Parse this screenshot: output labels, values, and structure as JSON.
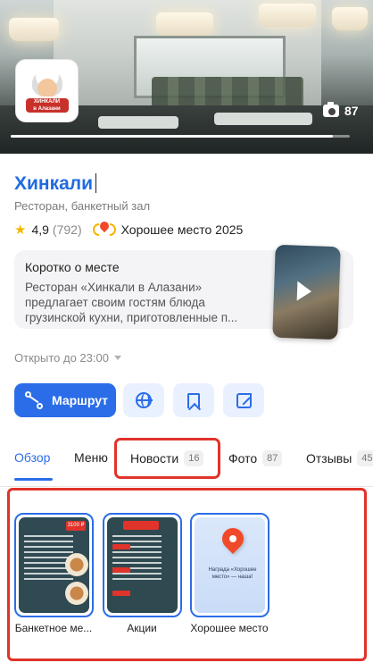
{
  "hero": {
    "photo_count": "87",
    "progress": 0.95
  },
  "logo": {
    "line1": "ХИНКАЛИ",
    "line2": "в Алазани"
  },
  "place": {
    "name": "Хинкали",
    "category": "Ресторан, банкетный зал",
    "rating": "4,9",
    "reviews_count": "(792)",
    "award": "Хорошее место 2025"
  },
  "about": {
    "title": "Коротко о месте",
    "text": "Ресторан «Хинкали в Алазани» предлагает своим гостям блюда грузинской кухни, приготовленные п..."
  },
  "hours": {
    "status": "Открыто до 23:00"
  },
  "actions": {
    "route_label": "Маршрут"
  },
  "tabs": [
    {
      "label": "Обзор"
    },
    {
      "label": "Меню"
    },
    {
      "label": "Новости",
      "count": "16"
    },
    {
      "label": "Фото",
      "count": "87"
    },
    {
      "label": "Отзывы",
      "count": "45"
    }
  ],
  "stories": [
    {
      "label": "Банкетное ме...",
      "price": "3100 ₽"
    },
    {
      "label": "Акции"
    },
    {
      "label": "Хорошее место",
      "text": "Награда «Хорошее место» — наша!"
    }
  ],
  "colors": {
    "accent": "#2b6de8",
    "highlight": "#e0332a",
    "star": "#f6b800"
  }
}
